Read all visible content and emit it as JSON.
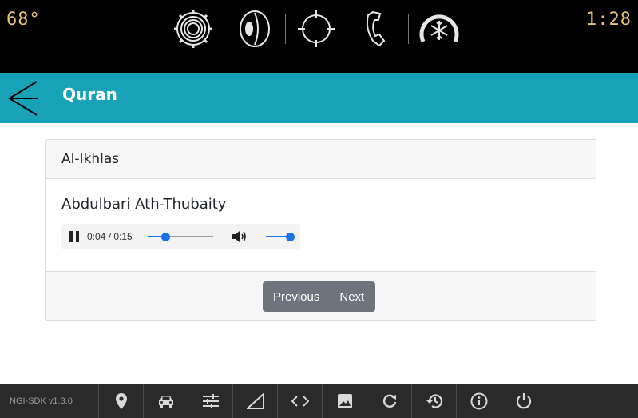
{
  "status_bar": {
    "temperature": "68°",
    "time": "1:28",
    "icons": [
      "settings-gear-icon",
      "speaker-icon",
      "location-crosshair-icon",
      "phone-icon",
      "climate-fan-icon"
    ]
  },
  "header": {
    "back_icon": "back-arrow-icon",
    "title": "Quran"
  },
  "card": {
    "surah": "Al-Ikhlas",
    "reciter": "Abdulbari Ath-Thubaity",
    "player": {
      "time_display": "0:04 / 0:15",
      "playing": true,
      "progress": 0.27,
      "volume": 1.0
    },
    "buttons": {
      "previous": "Previous",
      "next": "Next"
    }
  },
  "bottom_bar": {
    "version": "NGI-SDK v1.3.0",
    "items": [
      "location-pin-icon",
      "car-icon",
      "sliders-icon",
      "signal-icon",
      "code-icon",
      "image-icon",
      "refresh-icon",
      "history-icon",
      "info-icon",
      "power-icon"
    ]
  },
  "colors": {
    "header_bg": "#17a2b8",
    "accent_blue": "#1a73e8",
    "button_gray": "#6c757d",
    "status_text": "#e8c17a"
  }
}
